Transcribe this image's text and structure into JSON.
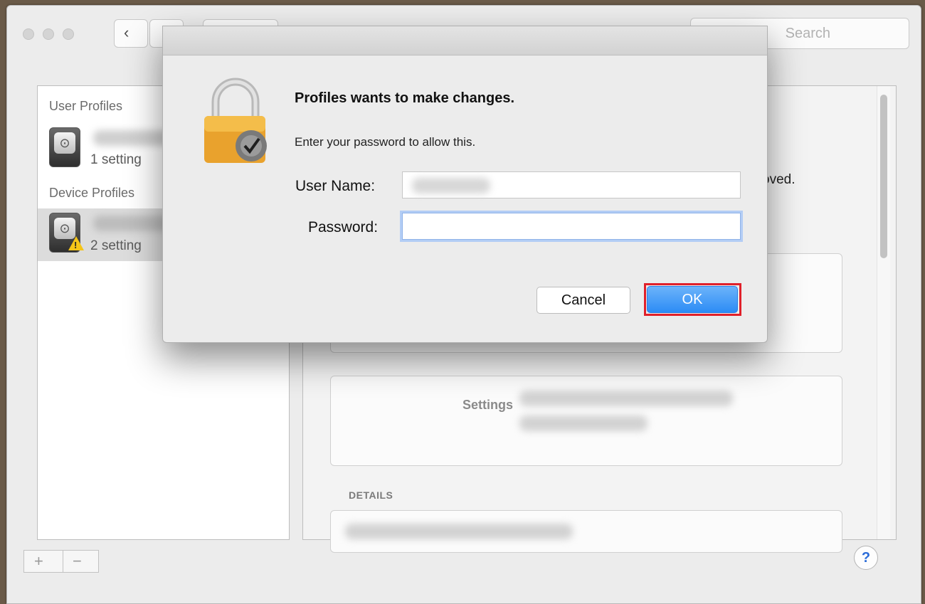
{
  "toolbar": {
    "search_placeholder": "Search"
  },
  "sidebar": {
    "user_profiles_header": "User Profiles",
    "device_profiles_header": "Device Profiles",
    "user_profile": {
      "setting_count": "1 setting"
    },
    "device_profile": {
      "setting_count": "2 setting"
    }
  },
  "detail": {
    "removed_text_fragment": "oved.",
    "settings_label": "Settings",
    "details_header": "DETAILS"
  },
  "footer": {
    "add_label": "+",
    "remove_label": "−",
    "help_label": "?"
  },
  "dialog": {
    "title": "Profiles wants to make changes.",
    "subtitle": "Enter your password to allow this.",
    "username_label": "User Name:",
    "password_label": "Password:",
    "username_value": "",
    "password_value": "",
    "cancel_label": "Cancel",
    "ok_label": "OK"
  },
  "colors": {
    "ok_accent": "#2c8cf5",
    "highlight_outline": "#e0202a",
    "warning": "#f5c518"
  },
  "icons": [
    "back-chevron-icon",
    "lock-icon",
    "gear-check-icon",
    "profile-icon",
    "warning-icon",
    "help-icon"
  ]
}
